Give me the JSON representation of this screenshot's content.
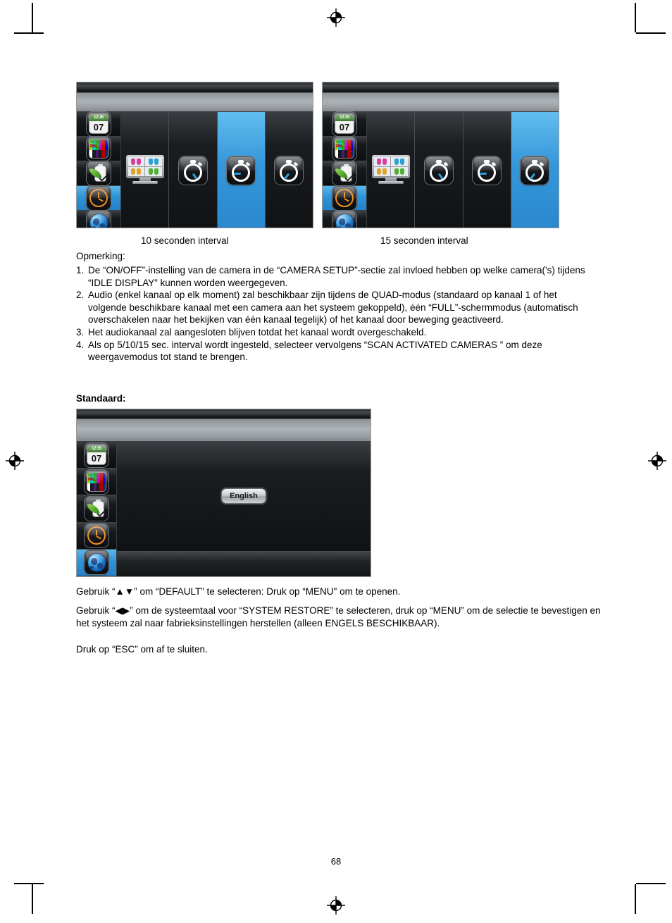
{
  "page": {
    "number": "68"
  },
  "figures": {
    "top": [
      {
        "caption": "10 seconden interval",
        "sidebar_icons": [
          "calendar-icon",
          "ntsc-pal-icon",
          "battery-eco-icon",
          "clock-icon",
          "globe-icon"
        ],
        "selected_sidebar_index": 3,
        "columns": [
          "quad-view-monitor-icon",
          "stopwatch-5s-icon",
          "stopwatch-10s-icon",
          "stopwatch-15s-icon"
        ],
        "selected_column_index": 2,
        "calendar_time": "12:35",
        "calendar_day": "07",
        "ntsc_label": "NTSC",
        "pal_label": "PAL"
      },
      {
        "caption": "15 seconden interval",
        "sidebar_icons": [
          "calendar-icon",
          "ntsc-pal-icon",
          "battery-eco-icon",
          "clock-icon",
          "globe-icon"
        ],
        "selected_sidebar_index": 3,
        "columns": [
          "quad-view-monitor-icon",
          "stopwatch-5s-icon",
          "stopwatch-10s-icon",
          "stopwatch-15s-icon"
        ],
        "selected_column_index": 3,
        "calendar_time": "12:35",
        "calendar_day": "07",
        "ntsc_label": "NTSC",
        "pal_label": "PAL"
      }
    ],
    "default_panel": {
      "button_label": "English",
      "sidebar_icons": [
        "calendar-icon",
        "ntsc-pal-icon",
        "battery-eco-icon",
        "clock-icon",
        "globe-icon"
      ],
      "selected_sidebar_index": 4,
      "calendar_time": "12:35",
      "calendar_day": "07",
      "ntsc_label": "NTSC",
      "pal_label": "PAL"
    }
  },
  "content": {
    "note_heading": "Opmerking:",
    "notes": [
      {
        "num": "1.",
        "text": "De “ON/OFF”-instelling van de camera in de “CAMERA SETUP”-sectie zal invloed hebben op welke camera('s) tijdens “IDLE DISPLAY” kunnen worden weergegeven."
      },
      {
        "num": "2.",
        "text": "Audio (enkel kanaal op elk moment) zal beschikbaar zijn tijdens de QUAD-modus (standaard op kanaal 1 of het volgende beschikbare kanaal met een camera aan het systeem gekoppeld), één “FULL”-schermmodus (automatisch overschakelen naar het bekijken van één kanaal tegelijk) of het kanaal door beweging geactiveerd."
      },
      {
        "num": "3.",
        "text": "Het audiokanaal zal aangesloten blijven totdat het kanaal wordt overgeschakeld."
      },
      {
        "num": "4.",
        "text": "Als op 5/10/15 sec. interval wordt ingesteld, selecteer vervolgens “SCAN ACTIVATED CAMERAS ” om deze weergavemodus tot stand te brengen."
      }
    ],
    "standaard_heading": "Standaard:",
    "instructions": [
      "Gebruik “▲▼” om “DEFAULT” te selecteren: Druk op “MENU\" om te openen.",
      "Gebruik “◀▶” om de systeemtaal voor “SYSTEM RESTORE” te selecteren, druk op “MENU” om de selectie te bevestigen en het systeem zal naar fabrieksinstellingen herstellen (alleen ENGELS BESCHIKBAAR).",
      "Druk op “ESC” om af te sluiten."
    ]
  },
  "colors": {
    "selection_blue": "#2e93d8",
    "panel_dark": "#101214",
    "header_gray": "#aeb3b7",
    "accent_orange": "#f09020"
  }
}
